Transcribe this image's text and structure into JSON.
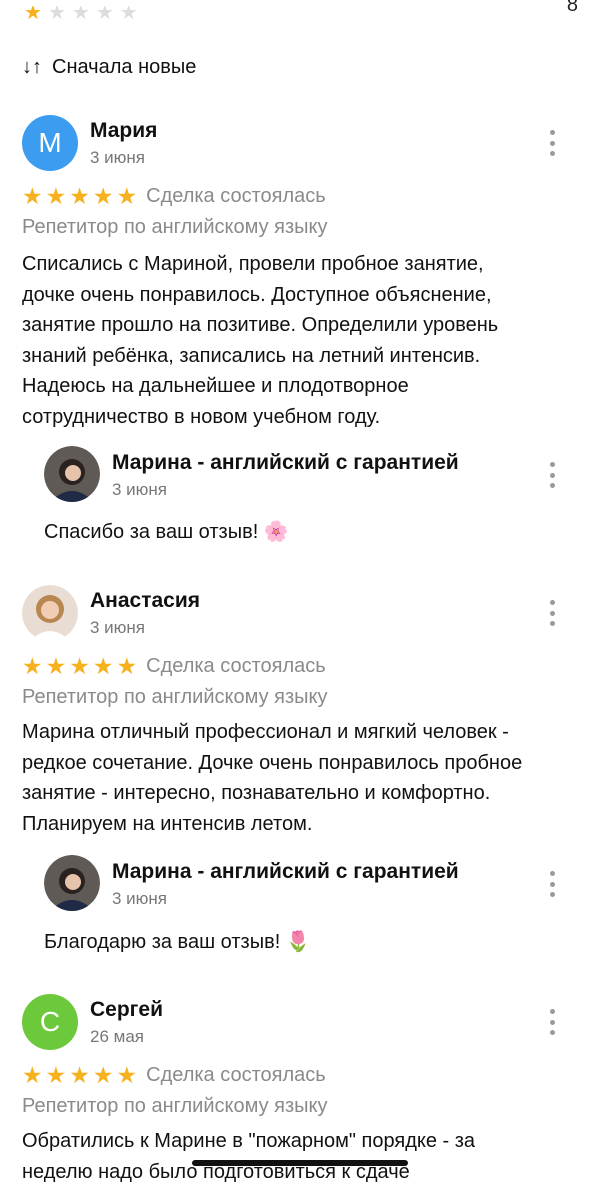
{
  "top": {
    "stars": [
      "★",
      "★",
      "★",
      "★",
      "★"
    ],
    "count": "8"
  },
  "sort": {
    "icon": "↓↑",
    "label": "Сначала новые"
  },
  "colors": {
    "star": "#f6b11e",
    "muted": "#8a8a8a",
    "avatar_m": "#3b9cf0",
    "avatar_s": "#6cc93c"
  },
  "reviews": [
    {
      "initial": "М",
      "name": "Мария",
      "date": "3 июня",
      "stars": [
        "★",
        "★",
        "★",
        "★",
        "★"
      ],
      "status": "Сделка состоялась",
      "category": "Репетитор по английскому языку",
      "text": "Списались с Мариной, провели пробное занятие,\nдочке очень понравилось. Доступное объяснение,\nзанятие прошло на позитиве. Определили уровень\nзнаний ребёнка, записались на летний интенсив.\nНадеюсь на дальнейшее и плодотворное\nсотрудничество в новом учебном году.",
      "reply": {
        "name": "Марина - английский с гарантией",
        "date": "3 июня",
        "text": "Спасибо за ваш отзыв! 🌸"
      }
    },
    {
      "initial": "",
      "name": "Анастасия",
      "date": "3 июня",
      "stars": [
        "★",
        "★",
        "★",
        "★",
        "★"
      ],
      "status": "Сделка состоялась",
      "category": "Репетитор по английскому языку",
      "text": "Марина отличный профессионал и  мягкий человек -\nредкое сочетание. Дочке очень понравилось пробное\nзанятие - интересно, познавательно и комфортно.\nПланируем на интенсив летом.",
      "reply": {
        "name": "Марина - английский с гарантией",
        "date": "3 июня",
        "text": "Благодарю за ваш отзыв! 🌷"
      }
    },
    {
      "initial": "С",
      "name": "Сергей",
      "date": "26 мая",
      "stars": [
        "★",
        "★",
        "★",
        "★",
        "★"
      ],
      "status": "Сделка состоялась",
      "category": "Репетитор по английскому языку",
      "text": "Обратились к Марине в \"пожарном\" порядке - за\nнеделю надо было подготовиться к сдаче"
    }
  ]
}
